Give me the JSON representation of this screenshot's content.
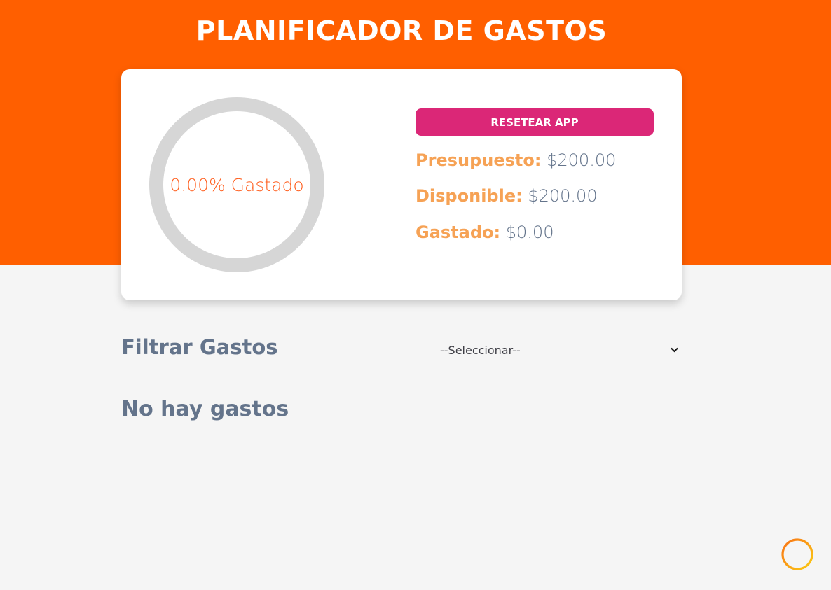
{
  "header": {
    "title": "PLANIFICADOR DE GASTOS"
  },
  "budget": {
    "progress_percent": 0,
    "progress_label": "0.00% Gastado",
    "reset_label": "RESETEAR APP",
    "stats": [
      {
        "label": "Presupuesto:",
        "value": "$200.00"
      },
      {
        "label": "Disponible:",
        "value": "$200.00"
      },
      {
        "label": "Gastado:",
        "value": "$0.00"
      }
    ]
  },
  "filter": {
    "title": "Filtrar Gastos",
    "selected": "--Seleccionar--"
  },
  "expenses": {
    "empty_message": "No hay gastos"
  },
  "icons": {
    "add": "add-circle-icon",
    "chevron": "chevron-down-icon"
  },
  "colors": {
    "header": "#ff5f00",
    "reset_button": "#db2777",
    "stat_label": "#f6a255",
    "text_slate": "#64748b",
    "progress_track": "#d6d6d6",
    "progress_text": "#ff5f1f",
    "add_icon": "#f59e0b"
  }
}
